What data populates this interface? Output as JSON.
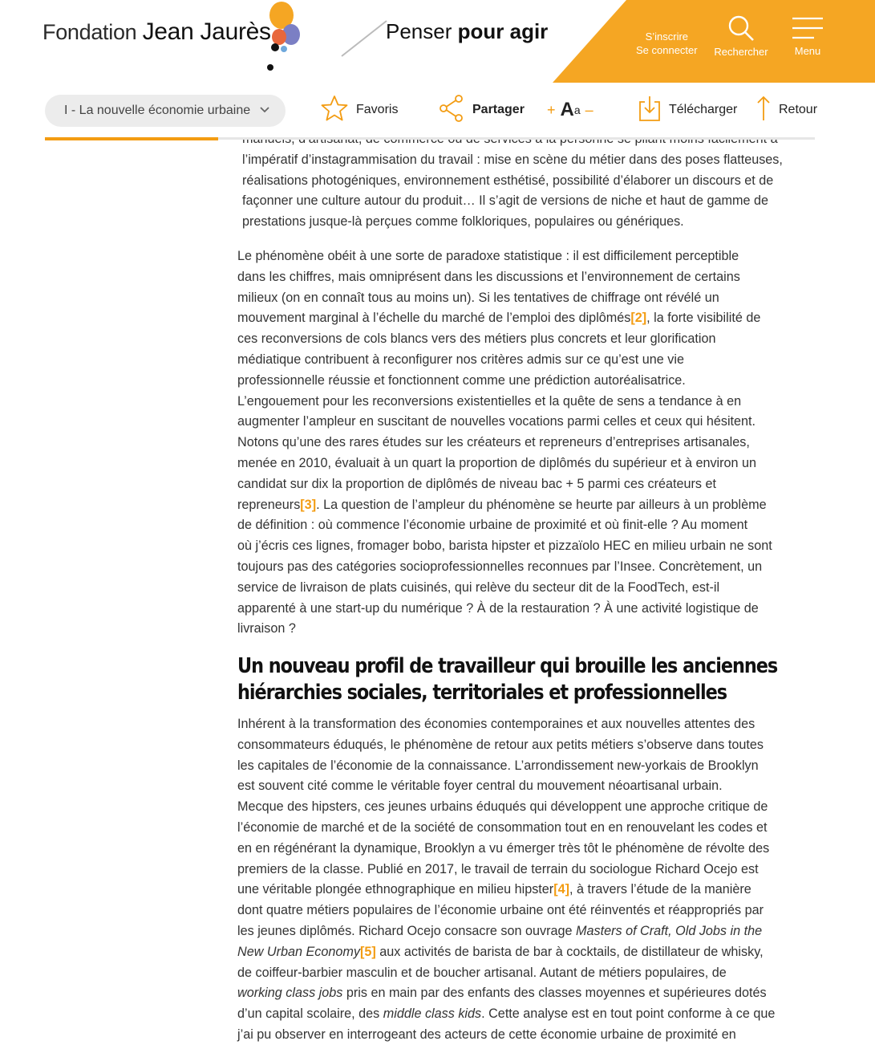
{
  "header": {
    "logo": {
      "prefix": "Fondation",
      "name": "Jean Jaurès"
    },
    "tagline": {
      "part1": "Penser",
      "part2": "pour agir"
    },
    "account": {
      "signup": "S’inscrire",
      "login": "Se connecter"
    },
    "search_label": "Rechercher",
    "menu_label": "Menu",
    "accent_color": "#f5a623"
  },
  "toolbar": {
    "chapter_select": "I - La nouvelle économie urbaine",
    "favoris": "Favoris",
    "partager": "Partager",
    "font_plus": "+",
    "font_big": "A",
    "font_small": "a",
    "font_minus": "–",
    "telecharger": "Télécharger",
    "retour": "Retour",
    "reading_progress_fraction": 0.225
  },
  "article": {
    "quote_lines": [
      "manuels, d’artisanat, de commerce ou de services à la personne se pliant moins facilement à",
      "l’impératif d’instagrammisation du travail : mise en scène du métier dans des poses flatteuses,",
      "réalisations photogéniques, environnement esthétisé, possibilité d’élaborer un discours et de",
      "façonner une culture autour du produit… Il s’agit de versions de niche et haut de gamme de",
      "prestations jusque-là perçues comme folkloriques, populaires ou génériques."
    ],
    "para1": {
      "lines_a": [
        "Le phénomène obéit à une sorte de paradoxe statistique : il est difficilement perceptible",
        "dans les chiffres, mais omniprésent dans les discussions et l’environnement de certains",
        "milieux (on en connaît tous au moins un). Si les tentatives de chiffrage ont révélé un"
      ],
      "line4_before": "mouvement marginal à l’échelle du marché de l’emploi des diplômés",
      "ref2": "[2]",
      "line4_after": ", la forte visibilité de",
      "lines_b": [
        "ces reconversions de cols blancs vers des métiers plus concrets et leur glorification",
        "médiatique contribuent à reconfigurer nos critères admis sur ce qu’est une vie",
        "professionnelle réussie et fonctionnent comme une prédiction autoréalisatrice.",
        "L’engouement pour les reconversions existentielles et la quête de sens a tendance à en",
        "augmenter l’ampleur en suscitant de nouvelles vocations parmi celles et ceux qui hésitent.",
        "Notons qu’une des rares études sur les créateurs et repreneurs d’entreprises artisanales,",
        "menée en 2010, évaluait à un quart la proportion de diplômés du supérieur et à environ un",
        "candidat sur dix la proportion de diplômés de niveau bac + 5 parmi ces créateurs et"
      ],
      "line12_before": "repreneurs",
      "ref3": "[3]",
      "line12_after": ". La question de l’ampleur du phénomène se heurte par ailleurs à un problème",
      "lines_c": [
        "de définition : où commence l’économie urbaine de proximité et où finit-elle ? Au moment",
        "où j’écris ces lignes, fromager bobo, barista hipster et pizzaïolo HEC en milieu urbain ne sont",
        "toujours pas des catégories socioprofessionnelles reconnues par l’Insee. Concrètement, un",
        "service de livraison de plats cuisinés, qui relève du secteur dit de la FoodTech, est-il",
        "apparenté à une start-up du numérique ? À de la restauration ? À une activité logistique de",
        "livraison ?"
      ]
    },
    "heading_line1": "Un nouveau profil de travailleur qui brouille les anciennes",
    "heading_line2": "hiérarchies sociales, territoriales et professionnelles",
    "para2": {
      "lines_a": [
        "Inhérent à la transformation des économies contemporaines et aux nouvelles attentes des",
        "consommateurs éduqués, le phénomène de retour aux petits métiers s’observe dans toutes",
        "les capitales de l’économie de la connaissance. L’arrondissement new-yorkais de Brooklyn",
        "est souvent cité comme le véritable foyer central du mouvement néoartisanal urbain.",
        "Mecque des hipsters, ces jeunes urbains éduqués qui développent une approche critique de",
        "l’économie de marché et de la société de consommation tout en en renouvelant les codes et",
        "en en régénérant la dynamique, Brooklyn a vu émerger très tôt le phénomène de révolte des",
        "premiers de la classe. Publié en 2017, le travail de terrain du sociologue Richard Ocejo est"
      ],
      "line9_before": "une véritable plongée ethnographique en milieu hipster",
      "ref4": "[4]",
      "line9_after": ", à travers l’étude de la manière",
      "line10": "dont quatre métiers populaires de l’économie urbaine ont été réinventés et réappropriés par",
      "line11_before": "les jeunes diplômés. Richard Ocejo consacre son ouvrage ",
      "line11_italic": "Masters of Craft, Old Jobs in the",
      "line12_italic": "New Urban Economy",
      "ref5": "[5]",
      "line12_after": " aux activités de barista de bar à cocktails, de distillateur de whisky,",
      "line13": "de coiffeur-barbier masculin et de boucher artisanal. Autant de métiers populaires, de",
      "line14_italic": "working class jobs",
      "line14_after": " pris en main par des enfants des classes moyennes et supérieures dotés",
      "line15_before": "d’un capital scolaire, des ",
      "line15_italic": "middle class kids",
      "line15_after": ". Cette analyse est en tout point conforme à ce que",
      "line16": "j’ai pu observer en interrogeant des acteurs de cette économie urbaine de proximité en"
    }
  }
}
